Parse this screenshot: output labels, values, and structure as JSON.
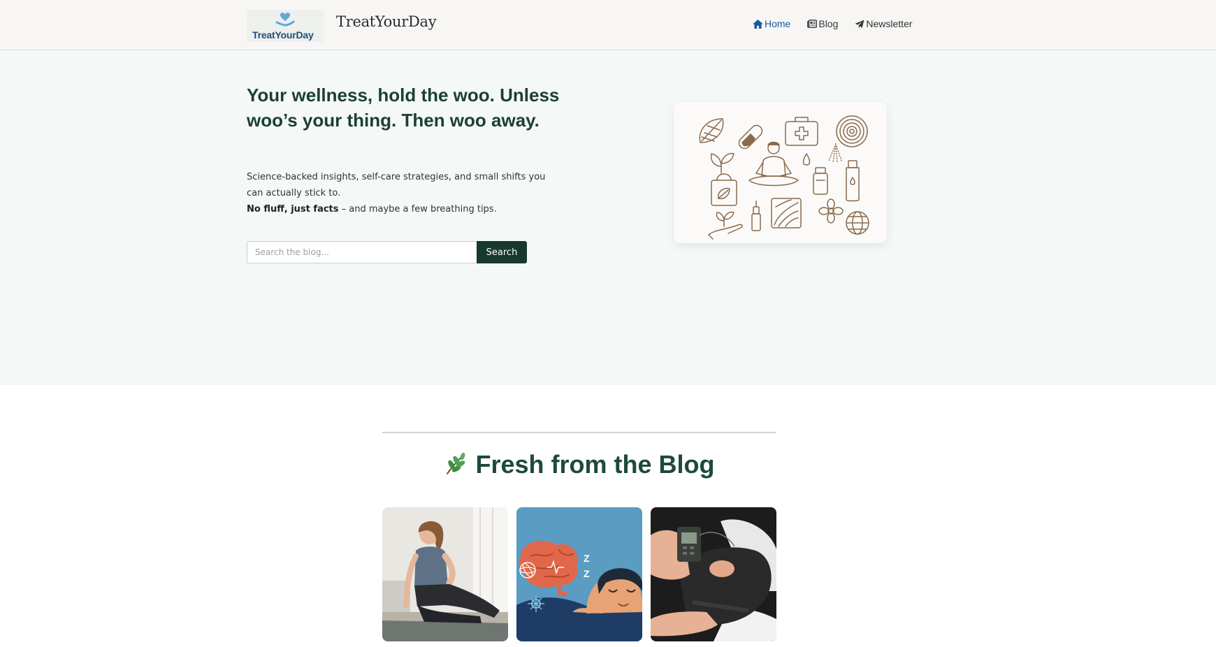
{
  "header": {
    "logo_text": "TreatYourDay",
    "site_title": "TreatYourDay",
    "nav": [
      {
        "label": "Home",
        "icon": "home-icon",
        "active": true
      },
      {
        "label": "Blog",
        "icon": "newspaper-icon",
        "active": false
      },
      {
        "label": "Newsletter",
        "icon": "paper-plane-icon",
        "active": false
      }
    ]
  },
  "hero": {
    "title": "Your wellness, hold the woo. Unless woo’s your thing. Then woo away.",
    "desc_line1": "Science-backed insights, self-care strategies, and small shifts you can actually stick to.",
    "desc_bold": "No fluff, just facts",
    "desc_rest": " – and maybe a few breathing tips.",
    "search_placeholder": "Search the blog...",
    "search_button": "Search"
  },
  "blog": {
    "section_icon": "herb-icon",
    "section_title": "Fresh from the Blog",
    "cards": [
      {
        "image": "woman-back-pain-yoga-image"
      },
      {
        "image": "brain-sleep-illustration-image"
      },
      {
        "image": "knee-tens-device-image"
      }
    ]
  },
  "colors": {
    "primary_dark": "#18392f",
    "heading_green": "#1c3f35",
    "nav_active": "#1a5aa0",
    "hero_bg": "#f4f8f6",
    "header_bg": "#f7f6f4"
  }
}
